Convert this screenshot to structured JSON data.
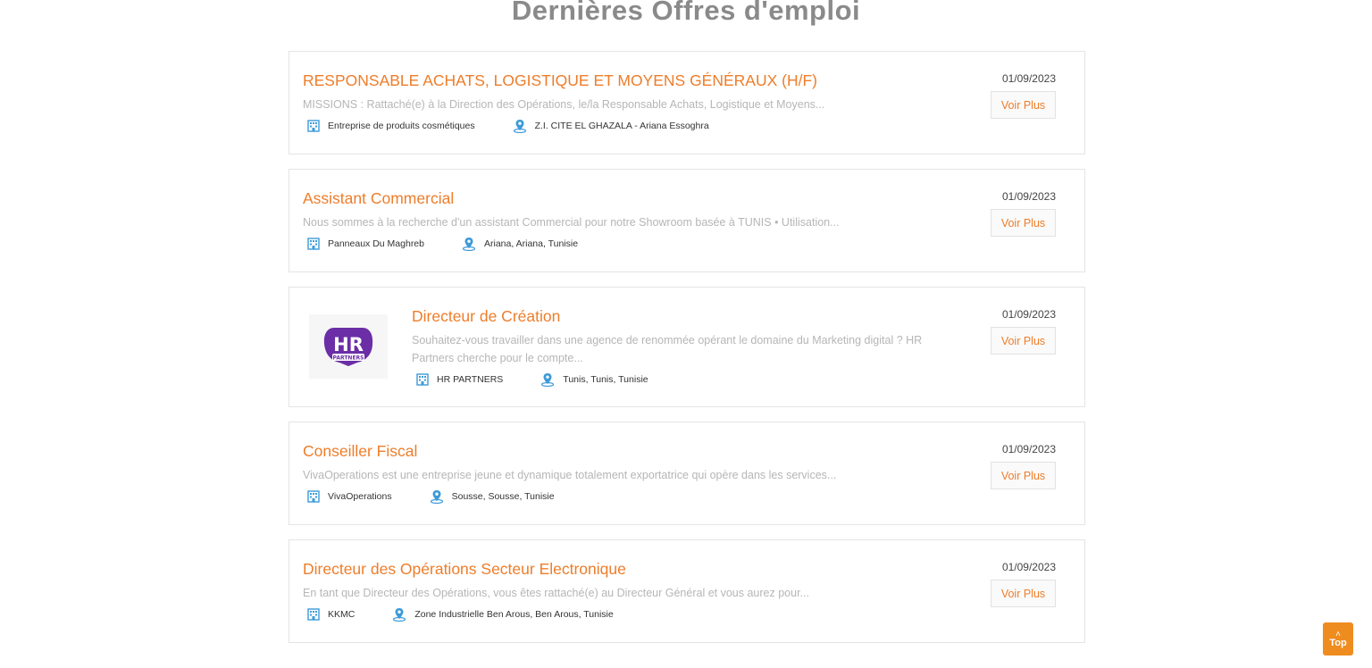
{
  "section": {
    "title": "Dernières Offres d'emploi"
  },
  "colors": {
    "accent": "#ee7d2a",
    "pin": "#3d9ad8",
    "building": "#3d9ad8",
    "logo_purple": "#6b2ea6"
  },
  "jobs": [
    {
      "title": "RESPONSABLE ACHATS, LOGISTIQUE ET MOYENS GÉNÉRAUX (H/F)",
      "description": "MISSIONS  : Rattaché(e) à la Direction des Opérations, le/la Responsable Achats, Logistique et Moyens...",
      "company": "Entreprise de produits cosmétiques",
      "location": "Z.I. CITE EL GHAZALA - Ariana Essoghra",
      "date": "01/09/2023",
      "button": "Voir Plus"
    },
    {
      "title": "Assistant Commercial",
      "description": "Nous sommes à la recherche d'un assistant Commercial  pour notre  Showroom basée à TUNIS • Utilisation...",
      "company": "Panneaux Du Maghreb",
      "location": "Ariana, Ariana, Tunisie",
      "date": "01/09/2023",
      "button": "Voir Plus"
    },
    {
      "title": "Directeur de Création",
      "description": "Souhaitez-vous travailler dans une agence de renommée opérant le domaine du Marketing digital ? HR Partners cherche pour le compte...",
      "company": "HR PARTNERS",
      "location": "Tunis, Tunis, Tunisie",
      "date": "01/09/2023",
      "button": "Voir Plus",
      "logo": {
        "main": "HR",
        "sub": "PARTNERS"
      }
    },
    {
      "title": "Conseiller Fiscal",
      "description": "VivaOperations est une  entreprise jeune et dynamique  totalement exportatrice  qui opère dans les  services...",
      "company": "VivaOperations",
      "location": "Sousse, Sousse, Tunisie",
      "date": "01/09/2023",
      "button": "Voir Plus"
    },
    {
      "title": "Directeur des Opérations Secteur Electronique",
      "description": "En tant que Directeur des Opérations, vous êtes rattaché(e) au Directeur Général et vous aurez pour...",
      "company": "KKMC",
      "location": "Zone Industrielle Ben Arous, Ben Arous, Tunisie",
      "date": "01/09/2023",
      "button": "Voir Plus"
    }
  ],
  "scroll_top": {
    "label": "Top",
    "icon": "chevron-up-icon"
  }
}
